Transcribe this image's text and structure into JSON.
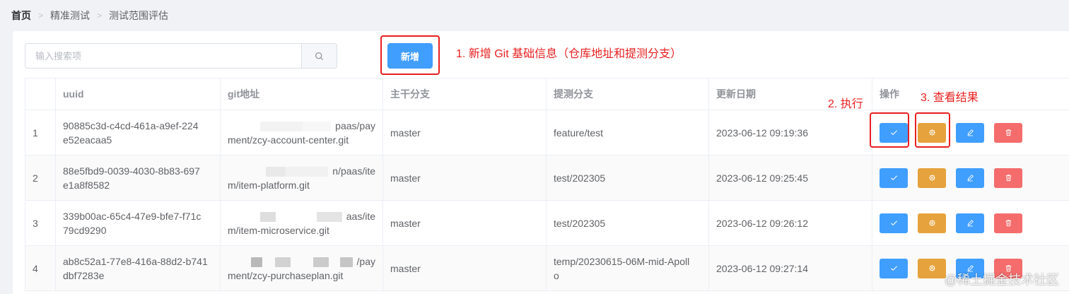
{
  "breadcrumb": [
    "首页",
    "精准测试",
    "测试范围评估"
  ],
  "search": {
    "placeholder": "输入搜索项"
  },
  "toolbar": {
    "add_label": "新增"
  },
  "annotations": {
    "add": "1. 新增 Git 基础信息（仓库地址和提测分支）",
    "execute": "2. 执行",
    "view": "3. 查看结果",
    "color": "#e81f1f"
  },
  "table": {
    "columns": [
      "",
      "uuid",
      "git地址",
      "主干分支",
      "提测分支",
      "更新日期",
      "操作"
    ],
    "rows": [
      {
        "index": "1",
        "uuid_line1": "90885c3d-c4cd-461a-a9ef-224",
        "uuid_line2": "e52eacaa5",
        "git_line1": "paas/pay",
        "git_line2": "ment/zcy-account-center.git",
        "main": "master",
        "test_line1": "feature/test",
        "test_line2": "",
        "date": "2023-06-12 09:19:36"
      },
      {
        "index": "2",
        "uuid_line1": "88e5fbd9-0039-4030-8b83-697",
        "uuid_line2": "e1a8f8582",
        "git_line1": "n/paas/ite",
        "git_line2": "m/item-platform.git",
        "main": "master",
        "test_line1": "test/202305",
        "test_line2": "",
        "date": "2023-06-12 09:25:45"
      },
      {
        "index": "3",
        "uuid_line1": "339b00ac-65c4-47e9-bfe7-f71c",
        "uuid_line2": "79cd9290",
        "git_line1": "aas/ite",
        "git_line2": "m/item-microservice.git",
        "main": "master",
        "test_line1": "test/202305",
        "test_line2": "",
        "date": "2023-06-12 09:26:12"
      },
      {
        "index": "4",
        "uuid_line1": "ab8c52a1-77e8-416a-88d2-b741",
        "uuid_line2": "dbf7283e",
        "git_line1": "/pay",
        "git_line2": "ment/zcy-purchaseplan.git",
        "main": "master",
        "test_line1": "temp/20230615-06M-mid-Apoll",
        "test_line2": "o",
        "date": "2023-06-12 09:27:14"
      }
    ]
  },
  "actions": {
    "execute_icon": "check-icon",
    "view_icon": "gear-icon",
    "edit_icon": "edit-icon",
    "delete_icon": "delete-icon"
  },
  "colors": {
    "primary": "#409eff",
    "warning": "#e6a23c",
    "danger": "#f56c6c"
  },
  "watermark": "@稀土掘金技术社区"
}
